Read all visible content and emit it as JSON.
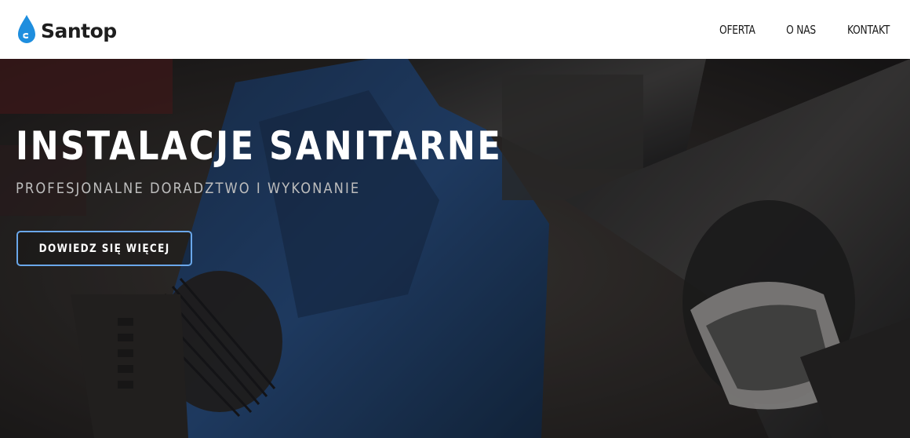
{
  "header": {
    "logo_text": "Santop",
    "logo_icon": "water-drop-icon",
    "nav": [
      {
        "label": "OFERTA"
      },
      {
        "label": "O NAS"
      },
      {
        "label": "KONTAKT"
      }
    ]
  },
  "hero": {
    "title": "INSTALACJE SANITARNE",
    "subtitle": "PROFESJONALNE DORADZTWO I WYKONANIE",
    "button_label": "DOWIEDZ SIĘ WIĘCEJ",
    "background_image": "pipe-wrench-photo"
  },
  "colors": {
    "brand_blue": "#1e8ede",
    "button_border": "#6aa7ea",
    "header_bg": "#ffffff",
    "title_text": "#ffffff",
    "subtitle_text": "#bdbdbd"
  }
}
